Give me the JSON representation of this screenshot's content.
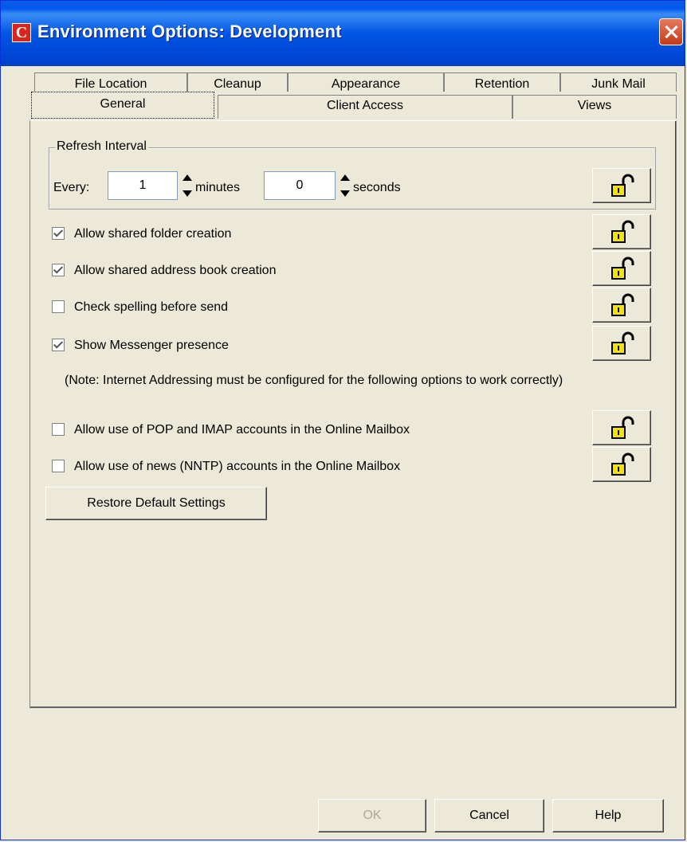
{
  "window": {
    "title": "Environment Options:  Development",
    "app_icon_glyph": "C"
  },
  "tabs": {
    "back_row": [
      "File Location",
      "Cleanup",
      "Appearance",
      "Retention",
      "Junk Mail"
    ],
    "front_row": [
      "General",
      "Client Access",
      "Views"
    ],
    "active": "General"
  },
  "refresh_interval": {
    "legend": "Refresh Interval",
    "every_label": "Every:",
    "minutes_value": "1",
    "minutes_label": "minutes",
    "seconds_value": "0",
    "seconds_label": "seconds"
  },
  "options": [
    {
      "label": "Allow shared folder creation",
      "checked": true
    },
    {
      "label": "Allow shared address book creation",
      "checked": true
    },
    {
      "label": "Check spelling before send",
      "checked": false
    },
    {
      "label": "Show Messenger presence",
      "checked": true
    }
  ],
  "note": "(Note: Internet Addressing must be configured for the following options to work correctly)",
  "internet_options": [
    {
      "label": "Allow use of POP and IMAP accounts in the Online Mailbox",
      "checked": false
    },
    {
      "label": "Allow use of news (NNTP) accounts in the Online Mailbox",
      "checked": false
    }
  ],
  "restore_button": "Restore Default Settings",
  "footer": {
    "ok": "OK",
    "cancel": "Cancel",
    "help": "Help"
  },
  "colors": {
    "dialog_bg": "#ece9d8",
    "titlebar": "#0055e5",
    "close_button": "#c33b17",
    "lock_yellow": "#f2e400"
  }
}
